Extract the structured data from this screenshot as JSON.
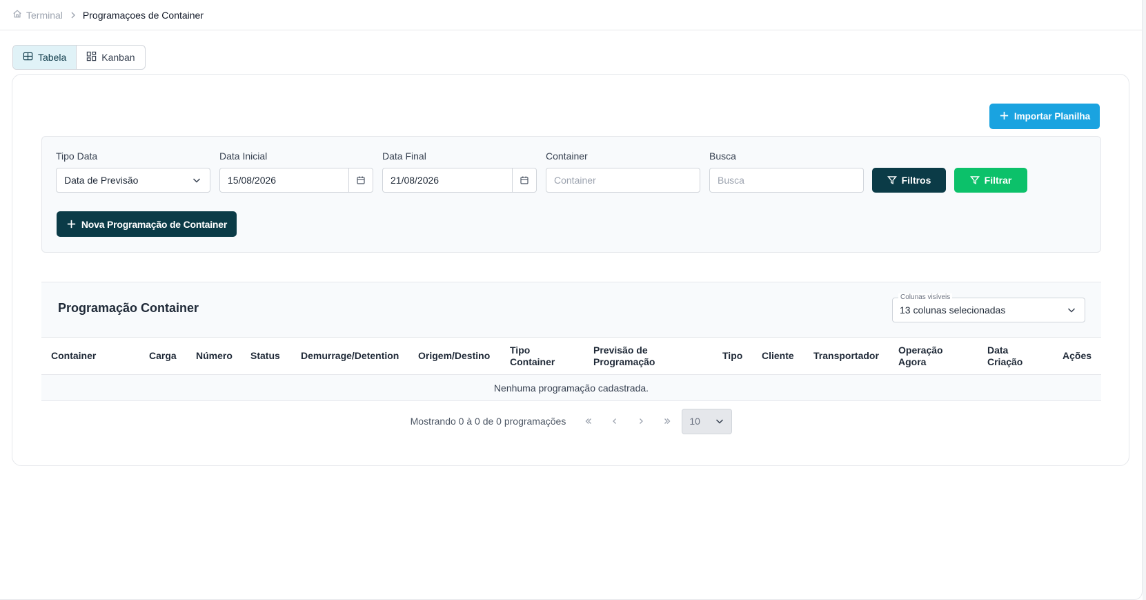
{
  "breadcrumb": {
    "home_label": "Terminal",
    "current_label": "Programaçoes de Container"
  },
  "view_toggle": {
    "table_label": "Tabela",
    "kanban_label": "Kanban",
    "active": "Tabela"
  },
  "actions": {
    "import_label": "Importar Planilha",
    "new_label": "Nova Programação de Container",
    "filters_label": "Filtros",
    "apply_label": "Filtrar"
  },
  "filters": {
    "tipo_data": {
      "label": "Tipo Data",
      "value": "Data de Previsão"
    },
    "data_inicial": {
      "label": "Data Inicial",
      "value": "15/08/2026"
    },
    "data_final": {
      "label": "Data Final",
      "value": "21/08/2026"
    },
    "container": {
      "label": "Container",
      "placeholder": "Container",
      "value": ""
    },
    "busca": {
      "label": "Busca",
      "placeholder": "Busca",
      "value": ""
    }
  },
  "table": {
    "title": "Programação Container",
    "columns_select": {
      "legend": "Colunas visíveis",
      "value": "13 colunas selecionadas"
    },
    "columns": [
      "Container",
      "Carga",
      "Número",
      "Status",
      "Demurrage/Detention",
      "Origem/Destino",
      "Tipo Container",
      "Previsão de Programação",
      "Tipo",
      "Cliente",
      "Transportador",
      "Operação Agora",
      "Data Criação",
      "Ações"
    ],
    "empty_message": "Nenhuma programação cadastrada."
  },
  "pagination": {
    "info": "Mostrando 0 à 0 de 0 programações",
    "page_size": "10"
  },
  "colors": {
    "primary_dark": "#0b3b47",
    "accent_blue": "#1aa3e0",
    "accent_green": "#0cc16a"
  }
}
